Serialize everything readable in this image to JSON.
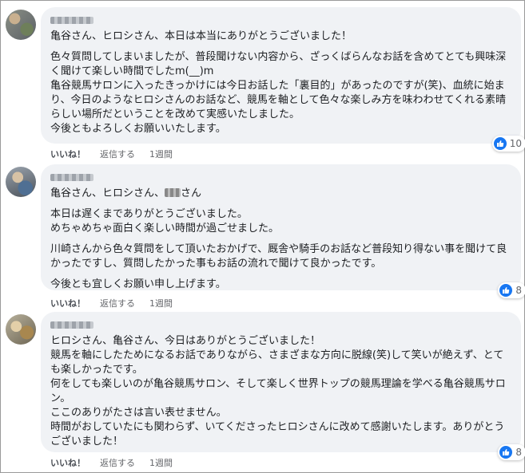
{
  "comments": [
    {
      "mention_line": "亀谷さん、ヒロシさん、本日は本当にありがとうございました！",
      "paragraphs": [
        "色々質問してしまいましたが、普段聞けない内容から、ざっくばらんなお話を含めてとても興味深く聞けて楽しい時間でしたm(__)m",
        "亀谷競馬サロンに入ったきっかけには今日お話した「裏目的」があったのですが(笑)、血統に始まり、今日のようなヒロシさんのお話など、競馬を軸として色々な楽しみ方を味わわせてくれる素晴らしい場所だということを改めて実感いたしました。",
        "今後ともよろしくお願いいたします。"
      ],
      "reaction_count": "10",
      "like_label": "いいね！",
      "reply_label": "返信する",
      "time": "1週間"
    },
    {
      "mention_line": "亀谷さん、ヒロシさん、",
      "mention_suffix": "さん",
      "paragraphs": [
        "本日は遅くまでありがとうございました。",
        "めちゃめちゃ面白く楽しい時間が過ごせました。",
        "川崎さんから色々質問をして頂いたおかげで、厩舎や騎手のお話など普段知り得ない事を聞けて良かったですし、質問したかった事もお話の流れで聞けて良かったです。",
        "今後とも宜しくお願い申し上げます。"
      ],
      "reaction_count": "8",
      "like_label": "いいね！",
      "reply_label": "返信する",
      "time": "1週間"
    },
    {
      "paragraphs": [
        "ヒロシさん、亀谷さん、今日はありがとうございました！",
        "競馬を軸にしたためになるお話でありながら、さまざまな方向に脱線(笑)して笑いが絶えず、とても楽しかったです。",
        "何をしても楽しいのが亀谷競馬サロン、そして楽しく世界トップの競馬理論を学べる亀谷競馬サロン。",
        "ここのありがたさは言い表せません。",
        "時間がおしていたにも関わらず、いてくださったヒロシさんに改めて感謝いたします。ありがとうございました！"
      ],
      "reaction_count": "8",
      "like_label": "いいね！",
      "reply_label": "返信する",
      "time": "1週間"
    }
  ]
}
